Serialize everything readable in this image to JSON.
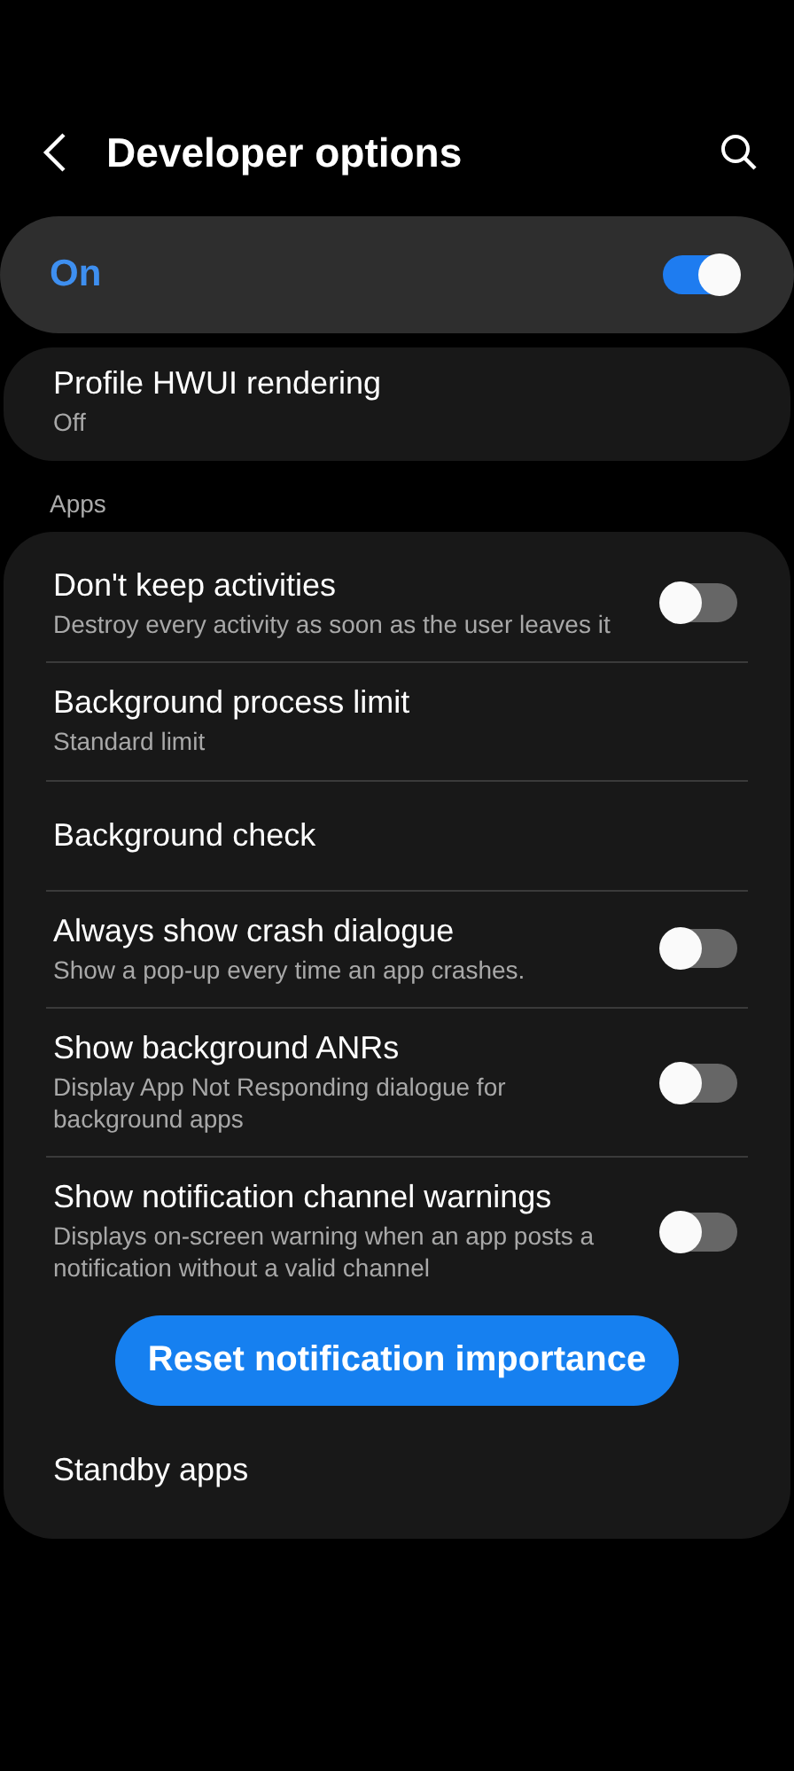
{
  "header": {
    "title": "Developer options"
  },
  "master": {
    "label": "On",
    "on": true
  },
  "scrolled_item": {
    "title": "Profile HWUI rendering",
    "value": "Off"
  },
  "section": {
    "title": "Apps"
  },
  "items": [
    {
      "kind": "toggle",
      "title": "Don't keep activities",
      "summary": "Destroy every activity as soon as the user leaves it",
      "on": false
    },
    {
      "kind": "value",
      "title": "Background process limit",
      "summary": "Standard limit"
    },
    {
      "kind": "plain",
      "title": "Background check"
    },
    {
      "kind": "toggle",
      "title": "Always show crash dialogue",
      "summary": "Show a pop-up every time an app crashes.",
      "on": false
    },
    {
      "kind": "toggle",
      "title": "Show background ANRs",
      "summary": "Display App Not Responding dialogue for background apps",
      "on": false
    },
    {
      "kind": "toggle",
      "title": "Show notification channel warnings",
      "summary": "Displays on-screen warning when an app posts a notification without a valid channel",
      "on": false
    },
    {
      "kind": "button",
      "title": "Reset notification importance"
    },
    {
      "kind": "plain",
      "title": "Standby apps"
    }
  ]
}
